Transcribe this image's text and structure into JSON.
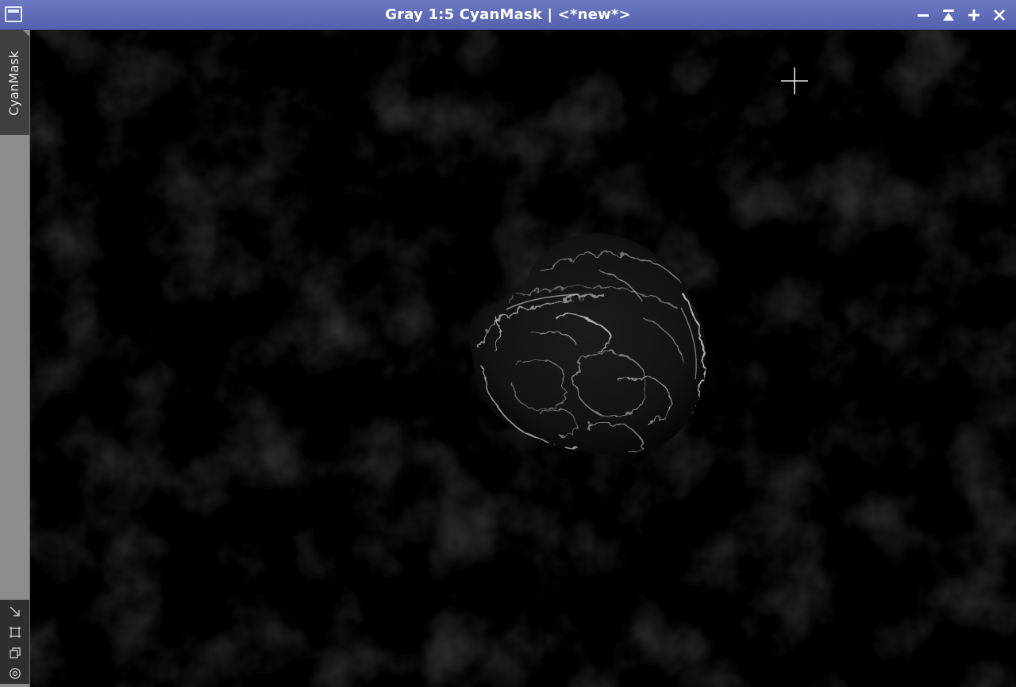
{
  "window": {
    "title": "Gray 1:5 CyanMask | <*new*>",
    "icon": "window-icon",
    "buttons": [
      {
        "name": "minimize",
        "icon": "minus-icon"
      },
      {
        "name": "shade",
        "icon": "shade-icon"
      },
      {
        "name": "maximize",
        "icon": "plus-icon"
      },
      {
        "name": "close",
        "icon": "close-icon"
      }
    ]
  },
  "sidebar": {
    "tab_label": "CyanMask",
    "tools": [
      {
        "name": "resize-tool",
        "icon": "diagonal-arrow-icon"
      },
      {
        "name": "fit-tool",
        "icon": "fit-frame-icon"
      },
      {
        "name": "clone-tool",
        "icon": "clone-icon"
      },
      {
        "name": "target-tool",
        "icon": "target-icon"
      }
    ]
  },
  "image": {
    "description_colors": {
      "background": "#000000",
      "nebula": "#d9d9d9"
    },
    "cursor_icon": "crosshair-icon"
  },
  "colors": {
    "titlebar": "#5f6bb8",
    "sidebar": "#8c8c8c",
    "tab_active": "#3f3f3f"
  }
}
